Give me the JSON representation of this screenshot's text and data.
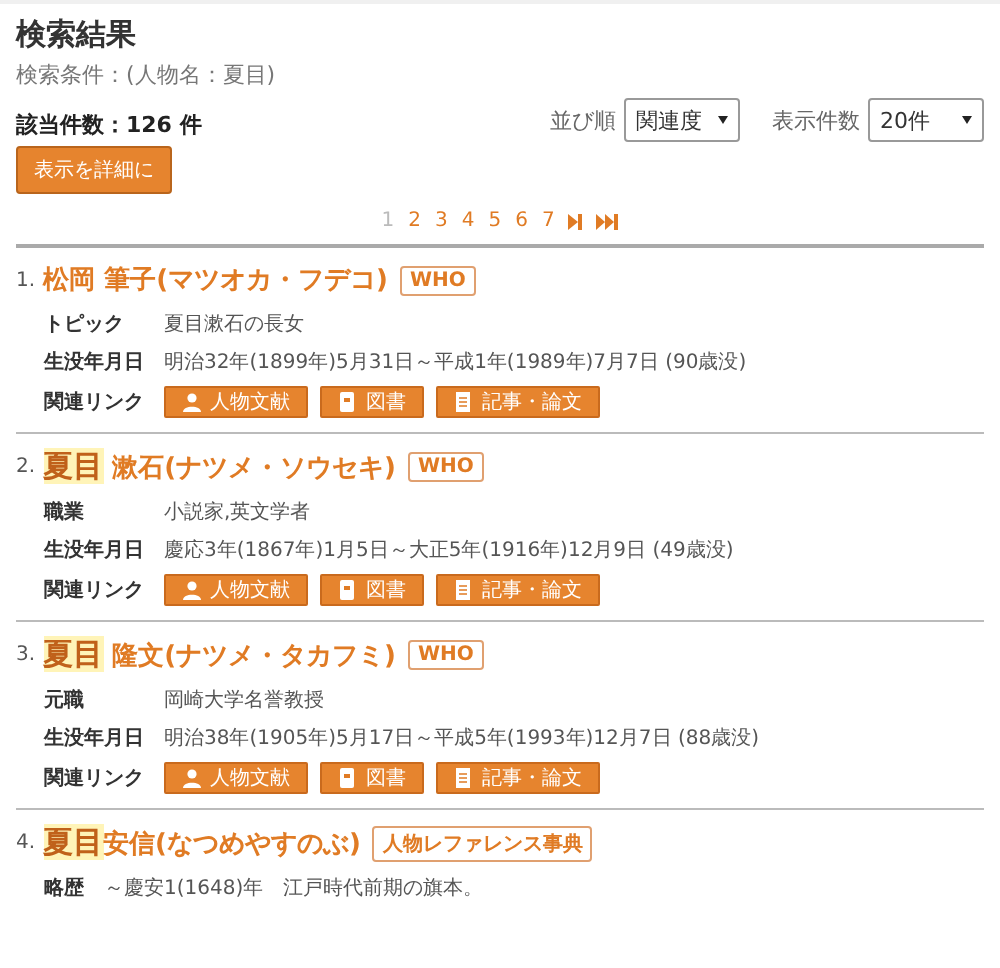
{
  "heading": "検索結果",
  "conditions": "検索条件：(人物名：夏目)",
  "count": "該当件数：126 件",
  "sort": {
    "label": "並び順",
    "value": "関連度"
  },
  "per_page": {
    "label": "表示件数",
    "value": "20件"
  },
  "detail_button": "表示を詳細に",
  "pages": [
    {
      "label": "1",
      "selected": true
    },
    {
      "label": "2",
      "selected": false
    },
    {
      "label": "3",
      "selected": false
    },
    {
      "label": "4",
      "selected": false
    },
    {
      "label": "5",
      "selected": false
    },
    {
      "label": "6",
      "selected": false
    },
    {
      "label": "7",
      "selected": false
    }
  ],
  "results": [
    {
      "number": "1.",
      "title": "松岡 筆子(マツオカ・フデコ)",
      "badge": "WHO",
      "fields": [
        {
          "label": "トピック",
          "value": "夏目漱石の長女"
        },
        {
          "label": "生没年月日",
          "value": "明治32年(1899年)5月31日～平成1年(1989年)7月7日 (90歳没)"
        }
      ],
      "links_label": "関連リンク",
      "links": [
        {
          "kind": "person",
          "label": "人物文献"
        },
        {
          "kind": "book",
          "label": "図書"
        },
        {
          "kind": "article",
          "label": "記事・論文"
        }
      ]
    },
    {
      "number": "2.",
      "title_highlight": "夏目",
      "title": " 漱石(ナツメ・ソウセキ)",
      "badge": "WHO",
      "fields": [
        {
          "label": "職業",
          "value": "小説家,英文学者"
        },
        {
          "label": "生没年月日",
          "value": "慶応3年(1867年)1月5日～大正5年(1916年)12月9日 (49歳没)"
        }
      ],
      "links_label": "関連リンク",
      "links": [
        {
          "kind": "person",
          "label": "人物文献"
        },
        {
          "kind": "book",
          "label": "図書"
        },
        {
          "kind": "article",
          "label": "記事・論文"
        }
      ]
    },
    {
      "number": "3.",
      "title_highlight": "夏目",
      "title": " 隆文(ナツメ・タカフミ)",
      "badge": "WHO",
      "fields": [
        {
          "label": "元職",
          "value": "岡崎大学名誉教授"
        },
        {
          "label": "生没年月日",
          "value": "明治38年(1905年)5月17日～平成5年(1993年)12月7日 (88歳没)"
        }
      ],
      "links_label": "関連リンク",
      "links": [
        {
          "kind": "person",
          "label": "人物文献"
        },
        {
          "kind": "book",
          "label": "図書"
        },
        {
          "kind": "article",
          "label": "記事・論文"
        }
      ]
    },
    {
      "number": "4.",
      "title_highlight": "夏目",
      "title": "安信(なつめやすのぶ)",
      "badge": "人物レファレンス事典",
      "fields": [
        {
          "label": "略歴",
          "value": "～慶安1(1648)年　江戸時代前期の旗本。"
        }
      ]
    }
  ]
}
